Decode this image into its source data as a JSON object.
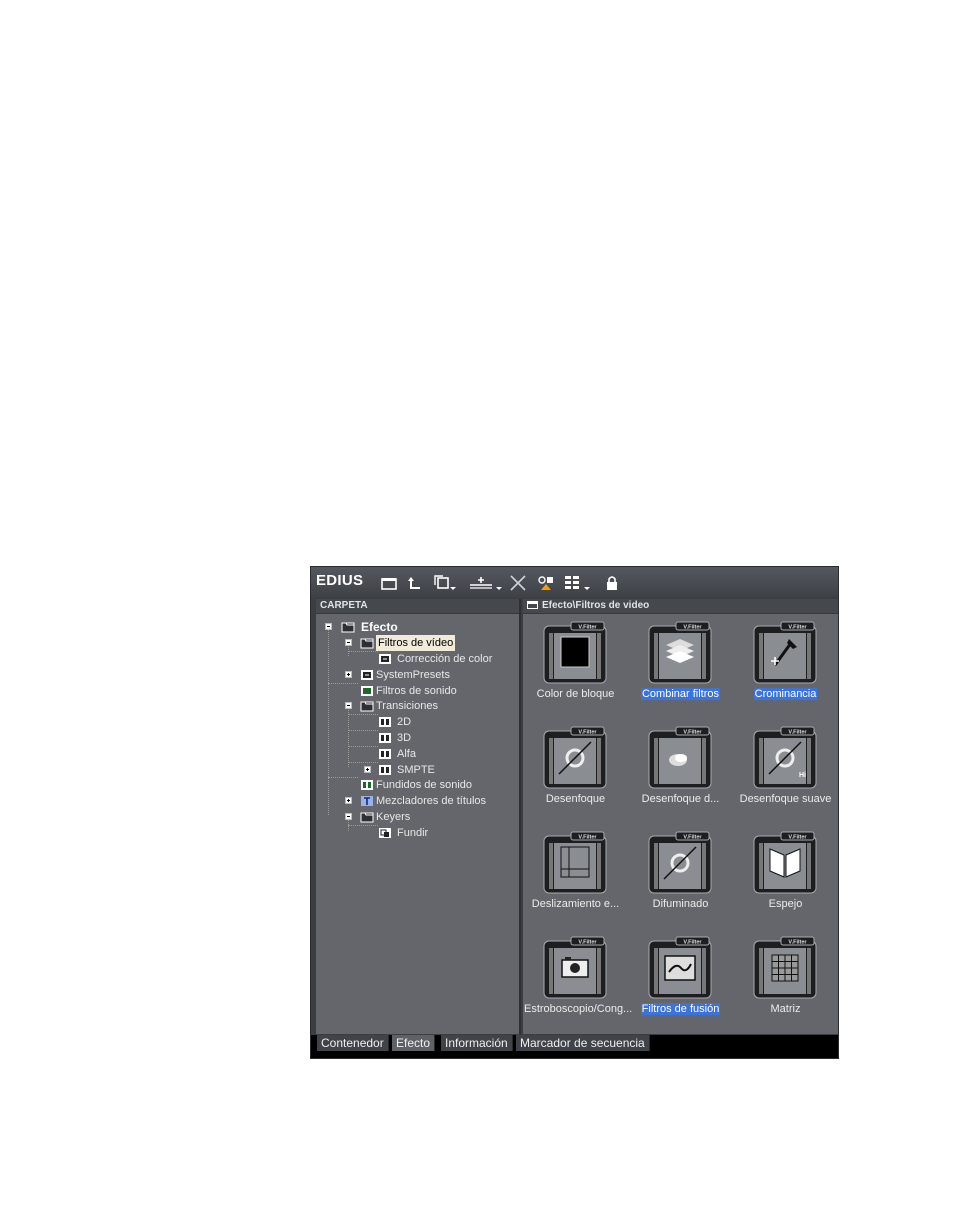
{
  "app": {
    "title": "EDIUS"
  },
  "colors": {
    "selection": "#3b74d6",
    "panel": "#64666b",
    "toolbar": "#45484d"
  },
  "toolbar": {
    "buttons": [
      {
        "name": "new-folder-icon"
      },
      {
        "name": "up-folder-icon"
      },
      {
        "name": "copy-dropdown-icon"
      },
      {
        "name": "add-dropdown-icon"
      },
      {
        "name": "delete-icon"
      },
      {
        "name": "properties-icon"
      },
      {
        "name": "view-mode-dropdown-icon"
      },
      {
        "name": "lock-icon"
      }
    ]
  },
  "left_panel": {
    "header": "CARPETA",
    "tree": [
      {
        "label": "Efecto"
      },
      {
        "label": "Filtros de vídeo"
      },
      {
        "label": "Corrección de color"
      },
      {
        "label": "SystemPresets"
      },
      {
        "label": "Filtros de sonido"
      },
      {
        "label": "Transiciones"
      },
      {
        "label": "2D"
      },
      {
        "label": "3D"
      },
      {
        "label": "Alfa"
      },
      {
        "label": "SMPTE"
      },
      {
        "label": "Fundidos de sonido"
      },
      {
        "label": "Mezcladores de títulos"
      },
      {
        "label": "Keyers"
      },
      {
        "label": "Fundir"
      }
    ]
  },
  "right_panel": {
    "header": "Efecto\\Filtros de video",
    "badge": "V.Filter",
    "tiles": [
      {
        "label": "Color de bloque",
        "selected": false
      },
      {
        "label": "Combinar filtros",
        "selected": true
      },
      {
        "label": "Crominancia",
        "selected": true
      },
      {
        "label": "Desenfoque",
        "selected": false
      },
      {
        "label": "Desenfoque d...",
        "selected": false
      },
      {
        "label": "Desenfoque suave",
        "selected": false
      },
      {
        "label": "Deslizamiento e...",
        "selected": false
      },
      {
        "label": "Difuminado",
        "selected": false
      },
      {
        "label": "Espejo",
        "selected": false
      },
      {
        "label": "Estroboscopio/Cong...",
        "selected": false
      },
      {
        "label": "Filtros de fusión",
        "selected": true
      },
      {
        "label": "Matriz",
        "selected": false
      }
    ],
    "hi_badge": "Hi"
  },
  "tabs": [
    {
      "label": "Contenedor",
      "active": false
    },
    {
      "label": "Efecto",
      "active": true
    },
    {
      "label": "Información",
      "active": false
    },
    {
      "label": "Marcador de secuencia",
      "active": false
    }
  ]
}
